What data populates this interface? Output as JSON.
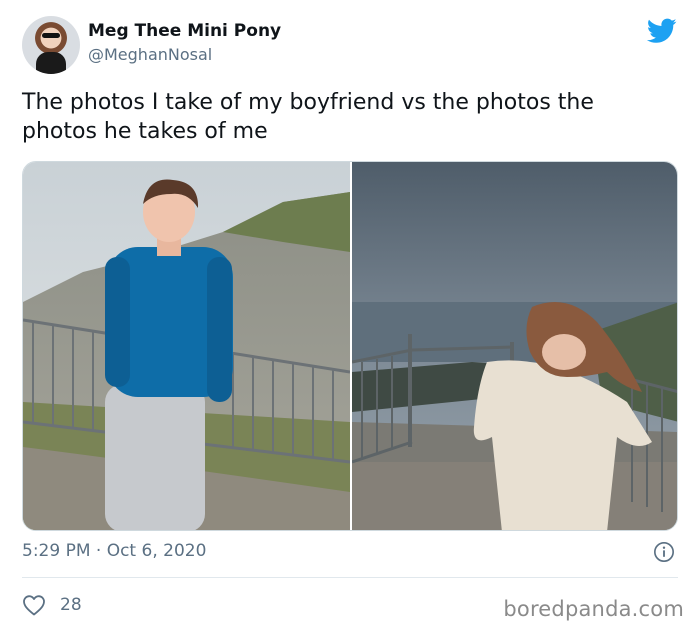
{
  "author": {
    "display_name": "Meg Thee Mini Pony",
    "handle": "@MeghanNosal"
  },
  "tweet": {
    "text": "The photos I take of my boyfriend vs the photos the photos he takes of me",
    "timestamp": "5:29 PM · Oct 6, 2020",
    "like_count": "28"
  },
  "icons": {
    "brand": "twitter-bird-icon",
    "info": "info-icon",
    "like": "heart-icon"
  },
  "colors": {
    "twitter_blue": "#1da1f2",
    "secondary_text": "#5b7083"
  },
  "watermark": "boredpanda.com"
}
